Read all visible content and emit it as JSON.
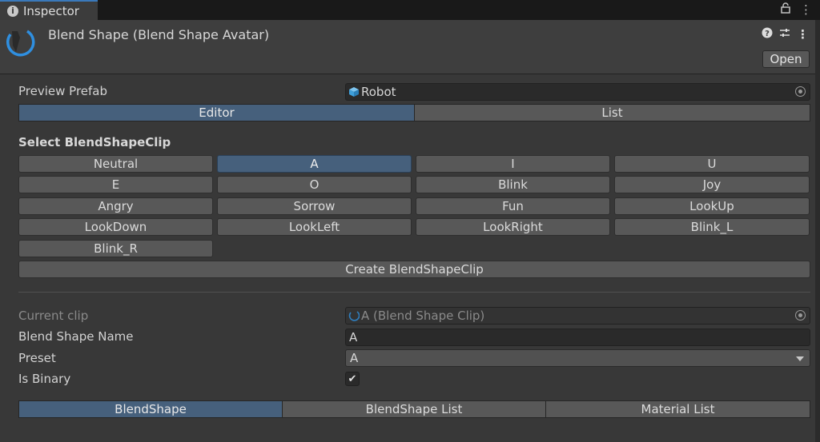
{
  "window": {
    "tab_title": "Inspector"
  },
  "header": {
    "title": "Blend Shape (Blend Shape Avatar)",
    "open_label": "Open"
  },
  "preview": {
    "label": "Preview Prefab",
    "value": "Robot"
  },
  "mode_tabs": [
    {
      "label": "Editor",
      "active": true
    },
    {
      "label": "List",
      "active": false
    }
  ],
  "select": {
    "title": "Select BlendShapeClip",
    "clips": [
      "Neutral",
      "A",
      "I",
      "U",
      "E",
      "O",
      "Blink",
      "Joy",
      "Angry",
      "Sorrow",
      "Fun",
      "LookUp",
      "LookDown",
      "LookLeft",
      "LookRight",
      "Blink_L",
      "Blink_R"
    ],
    "selected": "A",
    "create_label": "Create BlendShapeClip"
  },
  "clip": {
    "current_label": "Current clip",
    "current_value": "A (Blend Shape Clip)",
    "name_label": "Blend Shape Name",
    "name_value": "A",
    "preset_label": "Preset",
    "preset_value": "A",
    "binary_label": "Is Binary",
    "binary_checked": true
  },
  "bottom_tabs": [
    {
      "label": "BlendShape",
      "active": true
    },
    {
      "label": "BlendShape List",
      "active": false
    },
    {
      "label": "Material List",
      "active": false
    }
  ],
  "colors": {
    "accent": "#46607c",
    "tab_highlight": "#3a79bb"
  }
}
